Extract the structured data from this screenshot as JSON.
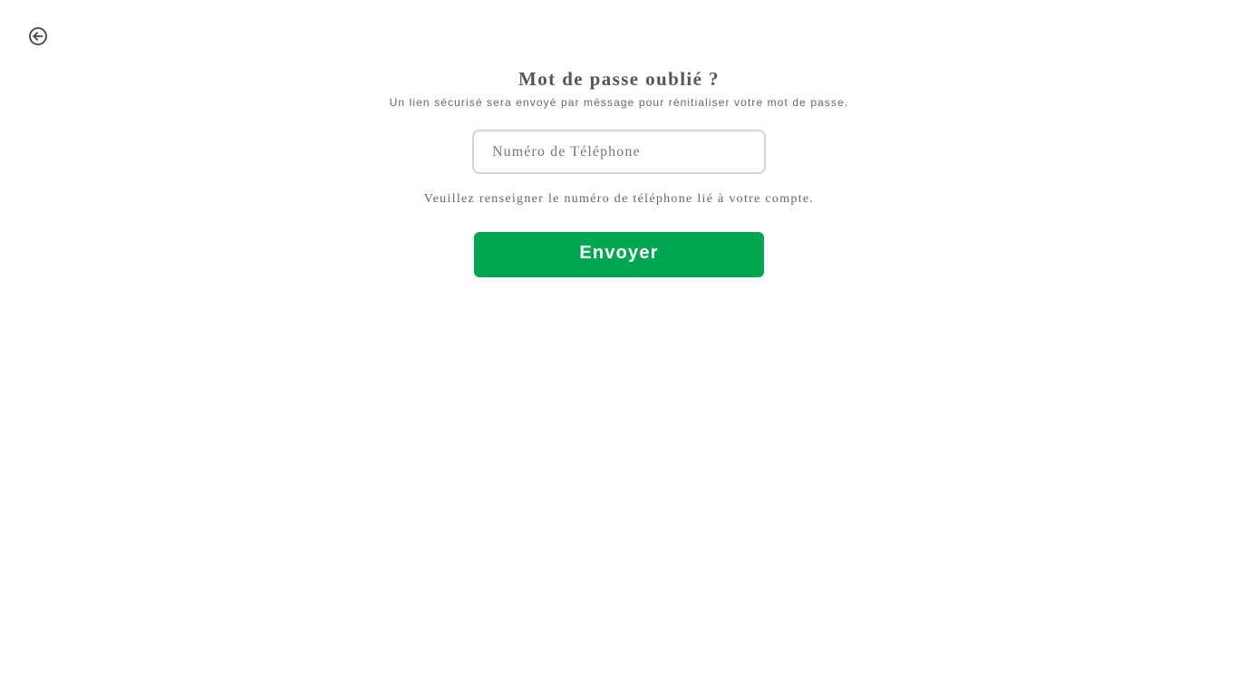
{
  "header": {
    "back_icon": "arrow-left-circle-icon"
  },
  "form": {
    "title": "Mot de passe oublié ?",
    "subtitle": "Un lien sécurisé sera envoyé par méssage pour rénitialiser votre mot de passe.",
    "phone_placeholder": "Numéro de Téléphone",
    "phone_value": "",
    "helper_text": "Veuillez renseigner le numéro de téléphone lié à votre compte.",
    "submit_label": "Envoyer"
  },
  "colors": {
    "accent": "#00a651",
    "text": "#555555",
    "field_border": "#d4d4d4",
    "background": "#ffffff"
  }
}
